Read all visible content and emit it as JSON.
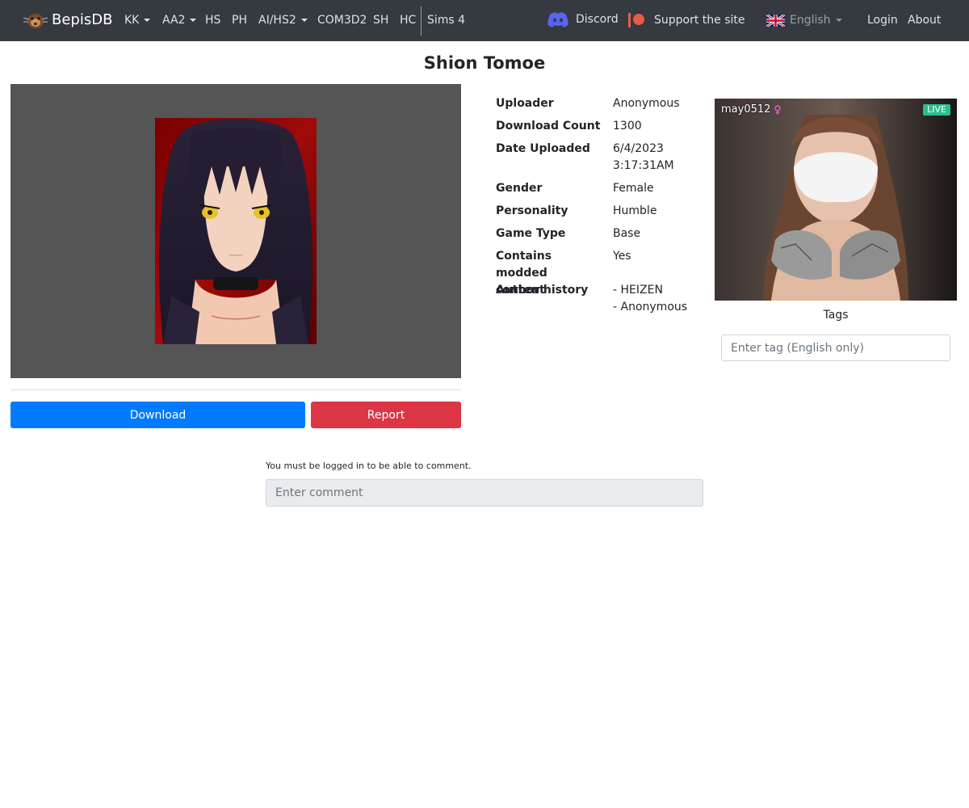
{
  "navbar": {
    "brand": "BepisDB",
    "items": [
      {
        "label": "KK",
        "dropdown": true
      },
      {
        "label": "AA2",
        "dropdown": true
      },
      {
        "label": "HS",
        "dropdown": false
      },
      {
        "label": "PH",
        "dropdown": false
      },
      {
        "label": "AI/HS2",
        "dropdown": true
      },
      {
        "label": "COM3D2",
        "dropdown": false
      },
      {
        "label": "SH",
        "dropdown": false
      },
      {
        "label": "HC",
        "dropdown": false
      },
      {
        "label": "Sims 4",
        "dropdown": false
      }
    ],
    "discord": "Discord",
    "support": "Support the site",
    "language": "English",
    "login": "Login",
    "about": "About"
  },
  "card": {
    "title": "Shion Tomoe"
  },
  "actions": {
    "download": "Download",
    "report": "Report"
  },
  "info": [
    {
      "label": "Uploader",
      "value": "Anonymous"
    },
    {
      "label": "Download Count",
      "value": "1300"
    },
    {
      "label": "Date Uploaded",
      "value": "6/4/2023 3:17:31AM"
    },
    {
      "label": "Gender",
      "value": "Female"
    },
    {
      "label": "Personality",
      "value": "Humble"
    },
    {
      "label": "Game Type",
      "value": "Base"
    },
    {
      "label": "Contains modded content",
      "value": "Yes"
    },
    {
      "label": "Author history",
      "value": "- HEIZEN\n- Anonymous"
    }
  ],
  "ad": {
    "username": "may0512",
    "badge": "LIVE"
  },
  "tags": {
    "label": "Tags",
    "placeholder": "Enter tag (English only)"
  },
  "comments": {
    "note": "You must be logged in to be able to comment.",
    "placeholder": "Enter comment"
  },
  "colors": {
    "navbar": "#343a40",
    "download": "#007bff",
    "report": "#dc3545",
    "live": "#2bbf8f"
  }
}
